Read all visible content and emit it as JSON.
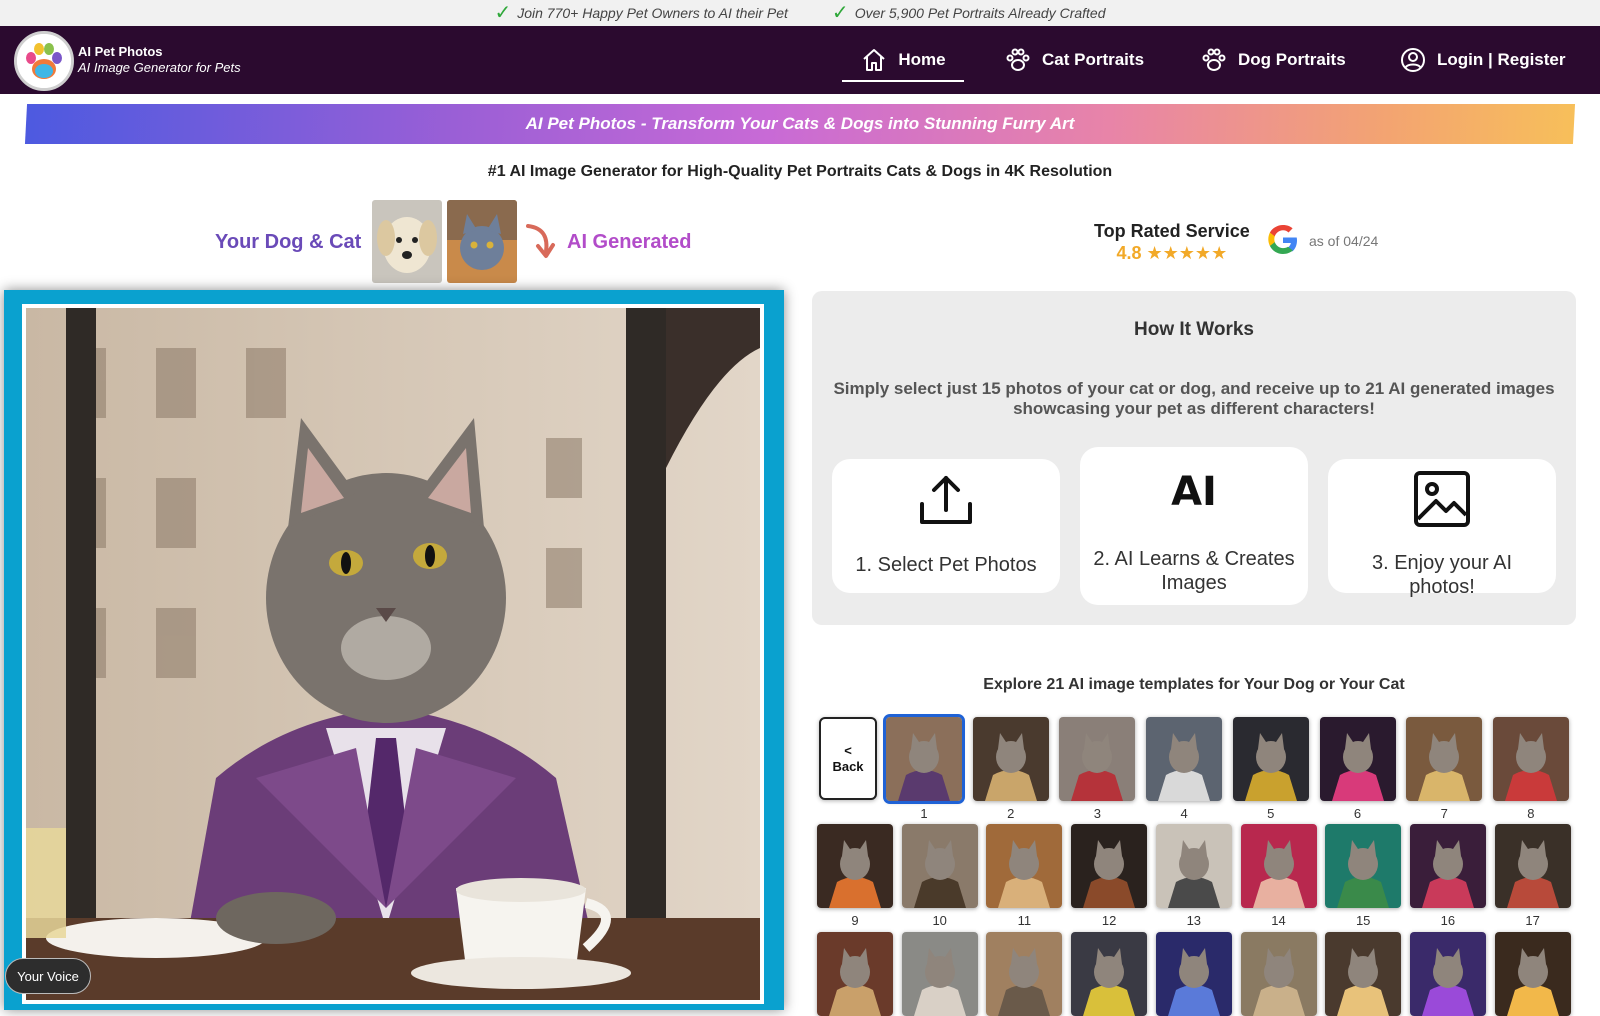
{
  "topstrip": {
    "left": "Join 770+ Happy Pet Owners to AI their Pet",
    "right": "Over 5,900 Pet Portraits Already Crafted"
  },
  "brand": {
    "name": "AI Pet Photos",
    "tagline": "AI Image Generator for Pets"
  },
  "nav": {
    "home": "Home",
    "cat": "Cat Portraits",
    "dog": "Dog Portraits",
    "login": "Login | Register"
  },
  "banner": "AI Pet Photos - Transform Your Cats & Dogs into Stunning Furry Art",
  "subhead": "#1 AI Image Generator for High-Quality Pet Portraits Cats & Dogs in 4K Resolution",
  "hero": {
    "your_pet": "Your Dog & Cat",
    "ai_generated": "AI Generated",
    "top_rated": "Top Rated Service",
    "rating": "4.8 ★★★★★",
    "as_of": "as of 04/24"
  },
  "how": {
    "title": "How It Works",
    "desc": "Simply select just 15 photos of your cat or dog, and receive up to 21 AI generated images showcasing your pet as different characters!",
    "step1": "1. Select Pet Photos",
    "step2_icon": "AI",
    "step2": "2. AI Learns & Creates Images",
    "step3": "3. Enjoy your AI photos!"
  },
  "templates": {
    "title": "Explore 21 AI image templates for Your Dog or Your Cat",
    "back_arrow": "<",
    "back_label": "Back",
    "row1": [
      "1",
      "2",
      "3",
      "4",
      "5",
      "6",
      "7",
      "8"
    ],
    "row2": [
      "9",
      "10",
      "11",
      "12",
      "13",
      "14",
      "15",
      "16",
      "17"
    ]
  },
  "voice": "Your Voice",
  "colors": {
    "nav_bg": "#2b0a2f",
    "frame": "#0aa1cf",
    "accent_purple": "#6a4ab8",
    "star": "#f2a928"
  }
}
